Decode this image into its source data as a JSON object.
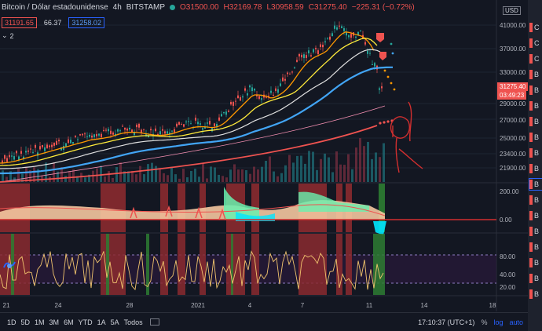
{
  "header": {
    "symbol": "Bitcoin / Dólar estadounidense",
    "interval": "4h",
    "exchange": "BITSTAMP",
    "open": "O31500.00",
    "high": "H32169.78",
    "low": "L30958.59",
    "close": "C31275.40",
    "change": "−225.31 (−0.72%)",
    "val1": "31191.65",
    "val2": "66.37",
    "val3": "31258.02",
    "collapse_count": "2"
  },
  "price_axis": {
    "currency": "USD",
    "ticks": [
      "45000.00",
      "41000.00",
      "37000.00",
      "33000.00",
      "29000.00",
      "27000.00",
      "25000.00",
      "23400.00",
      "21900.00"
    ],
    "last_price": "31275.40",
    "countdown": "03:49:23"
  },
  "indicator1_axis": {
    "ticks": [
      "200.00",
      "0.00"
    ]
  },
  "indicator2_axis": {
    "ticks": [
      "80.00",
      "40.00",
      "20.00"
    ]
  },
  "time_axis": {
    "labels": [
      "21",
      "24",
      "28",
      "2021",
      "4",
      "7",
      "11",
      "14",
      "18"
    ]
  },
  "bottom_bar": {
    "timeframes": [
      "1D",
      "5D",
      "1M",
      "3M",
      "6M",
      "YTD",
      "1A",
      "5A",
      "Todos"
    ],
    "clock": "17:10:37 (UTC+1)",
    "pct": "%",
    "log": "log",
    "auto": "auto"
  },
  "right_panel": {
    "items": [
      "C",
      "C",
      "C",
      "B",
      "B",
      "B",
      "B",
      "B",
      "B",
      "B",
      "B",
      "B",
      "B",
      "B",
      "B",
      "B",
      "B",
      "B"
    ]
  },
  "colors": {
    "bg": "#131722",
    "up": "#26a69a",
    "down": "#ef5350",
    "accent": "#2962ff"
  }
}
